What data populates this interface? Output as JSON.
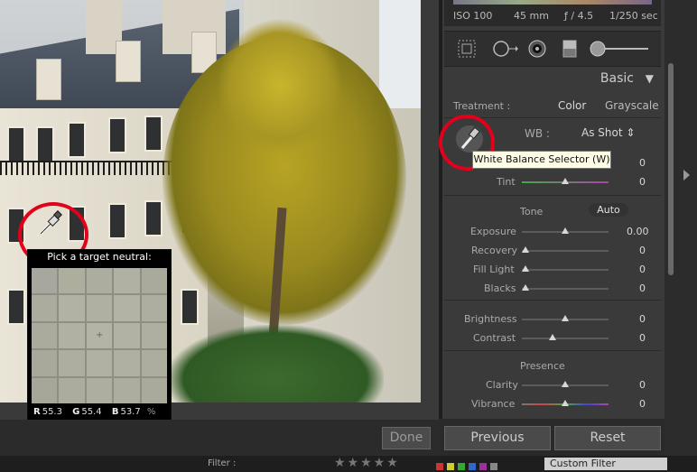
{
  "exif": {
    "iso": "ISO 100",
    "focal": "45 mm",
    "aperture": "ƒ / 4.5",
    "shutter": "1/250 sec"
  },
  "panel": {
    "section_title": "Basic",
    "treatment_label": "Treatment :",
    "treatment_color": "Color",
    "treatment_grayscale": "Grayscale",
    "wb_label": "WB :",
    "wb_value": "As Shot ⇕",
    "temp_value": "0",
    "tint_label": "Tint",
    "tint_value": "0",
    "tone_label": "Tone",
    "auto_label": "Auto",
    "exposure_label": "Exposure",
    "exposure_value": "0.00",
    "recovery_label": "Recovery",
    "recovery_value": "0",
    "filllight_label": "Fill Light",
    "filllight_value": "0",
    "blacks_label": "Blacks",
    "blacks_value": "0",
    "brightness_label": "Brightness",
    "brightness_value": "0",
    "contrast_label": "Contrast",
    "contrast_value": "0",
    "presence_label": "Presence",
    "clarity_label": "Clarity",
    "clarity_value": "0",
    "vibrance_label": "Vibrance",
    "vibrance_value": "0"
  },
  "tooltip": "White Balance Selector (W)",
  "loupe": {
    "title": "Pick a target neutral:",
    "r_label": "R",
    "r_value": "55.3",
    "g_label": "G",
    "g_value": "55.4",
    "b_label": "B",
    "b_value": "53.7",
    "unit": "%"
  },
  "buttons": {
    "done": "Done",
    "previous": "Previous",
    "reset": "Reset"
  },
  "filmstrip": {
    "filter_label": "Filter :",
    "stars": "★★★★★",
    "custom_filter": "Custom Filter"
  },
  "colors": {
    "highlight_circle": "#e2001a",
    "panel_bg": "#3a3a3a"
  }
}
